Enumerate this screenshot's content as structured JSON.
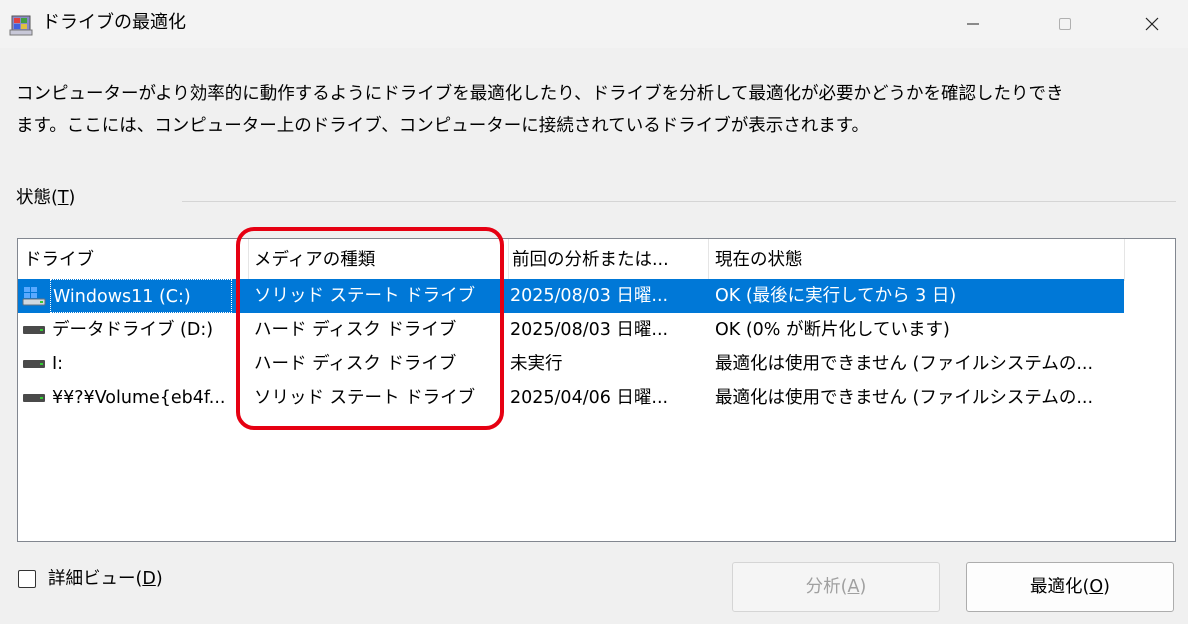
{
  "window": {
    "title": "ドライブの最適化",
    "icon": "defrag-app-icon",
    "controls": [
      "minimize-icon",
      "maximize-icon",
      "close-icon"
    ]
  },
  "description": {
    "line1": "コンピューターがより効率的に動作するようにドライブを最適化したり、ドライブを分析して最適化が必要かどうかを確認したりでき",
    "line2": "ます。ここには、コンピューター上のドライブ、コンピューターに接続されているドライブが表示されます。"
  },
  "status": {
    "label_prefix": "状態(",
    "label_key": "T",
    "label_suffix": ")"
  },
  "table": {
    "columns": [
      "ドライブ",
      "メディアの種類",
      "前回の分析または...",
      "現在の状態"
    ],
    "rows": [
      {
        "drive": "Windows11 (C:)",
        "media": "ソリッド ステート ドライブ",
        "last": "2025/08/03 日曜...",
        "state": "OK (最後に実行してから 3 日)",
        "icon": "windows-drive-icon",
        "selected": true
      },
      {
        "drive": "データドライブ (D:)",
        "media": "ハード ディスク ドライブ",
        "last": "2025/08/03 日曜...",
        "state": "OK (0% が断片化しています)",
        "icon": "hard-drive-icon",
        "selected": false
      },
      {
        "drive": "I:",
        "media": "ハード ディスク ドライブ",
        "last": "未実行",
        "state": "最適化は使用できません (ファイルシステムの...",
        "icon": "hard-drive-icon",
        "selected": false
      },
      {
        "drive": "¥¥?¥Volume{eb4f...",
        "media": "ソリッド ステート ドライブ",
        "last": "2025/04/06 日曜...",
        "state": "最適化は使用できません (ファイルシステムの...",
        "icon": "hard-drive-icon",
        "selected": false
      }
    ]
  },
  "detail_view": {
    "label_prefix": "詳細ビュー(",
    "label_key": "D",
    "label_suffix": ")",
    "checked": false
  },
  "buttons": {
    "analyze_prefix": "分析(",
    "analyze_key": "A",
    "analyze_suffix": ")",
    "optimize_prefix": "最適化(",
    "optimize_key": "O",
    "optimize_suffix": ")"
  },
  "colors": {
    "selection": "#0078d7",
    "annotation": "#e60012"
  }
}
